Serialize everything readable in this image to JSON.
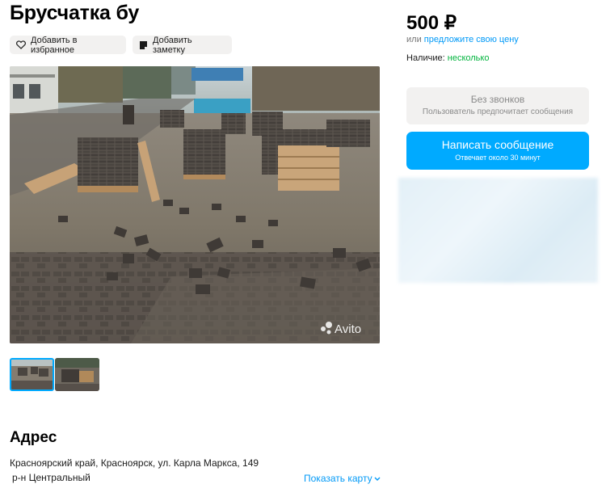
{
  "listing": {
    "title": "Брусчатка бу",
    "add_favorite_label": "Добавить в избранное",
    "add_note_label": "Добавить заметку",
    "watermark": "Avito"
  },
  "price": {
    "value": "500 ₽",
    "offer_prefix": "или",
    "offer_link": "предложите свою цену",
    "availability_label": "Наличие:",
    "availability_value": "несколько"
  },
  "contact": {
    "no_calls_title": "Без звонков",
    "no_calls_subtitle": "Пользователь предпочитает сообщения",
    "message_button": "Написать сообщение",
    "message_subtitle": "Отвечает около 30 минут"
  },
  "address": {
    "heading": "Адрес",
    "line1": "Красноярский край, Красноярск, ул. Карла Маркса, 149",
    "line2": "р-н Центральный",
    "show_map": "Показать карту"
  },
  "colors": {
    "accent": "#00aaff",
    "link": "#0099f7",
    "available": "#02b43e"
  }
}
